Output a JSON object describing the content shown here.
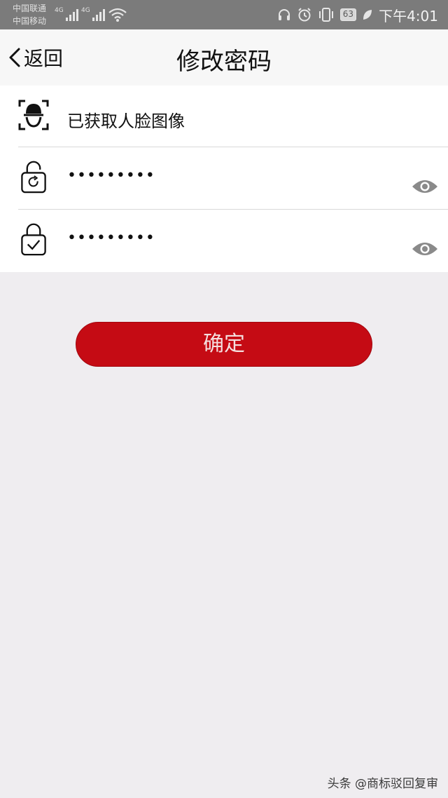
{
  "status_bar": {
    "carrier_1": "中国联通",
    "carrier_2": "中国移动",
    "network_1": "4G",
    "network_2": "4G",
    "battery": "63",
    "time": "下午4:01",
    "icons": [
      "headset-icon",
      "alarm-icon",
      "vibrate-icon",
      "battery-icon",
      "leaf-icon",
      "wifi-icon"
    ]
  },
  "nav": {
    "back_label": "返回",
    "title": "修改密码"
  },
  "form": {
    "face_status": "已获取人脸图像",
    "new_password_mask": "•••••••••",
    "confirm_password_mask": "•••••••••"
  },
  "confirm_button": {
    "label": "确定",
    "color": "#c50b14"
  },
  "watermark": "头条 @商标驳回复审"
}
